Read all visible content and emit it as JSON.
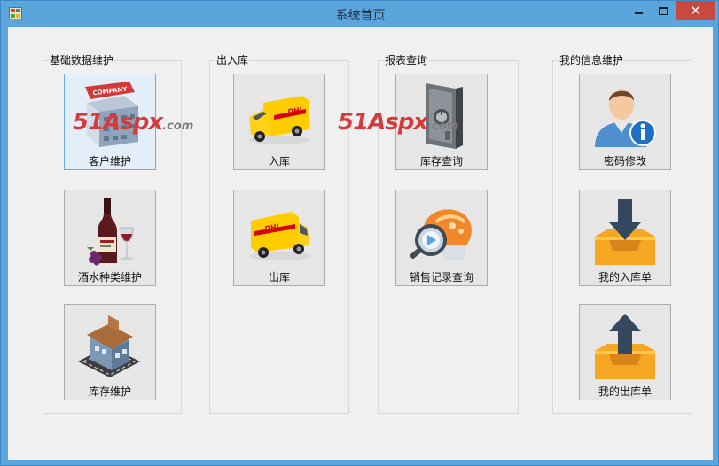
{
  "window": {
    "title": "系统首页",
    "close_glyph": "✕"
  },
  "groups": [
    {
      "caption": "基础数据维护",
      "tiles": [
        {
          "label": "客户维护",
          "icon": "company-building-icon",
          "selected": true
        },
        {
          "label": "酒水种类维护",
          "icon": "wine-bottle-icon",
          "selected": false
        },
        {
          "label": "库存维护",
          "icon": "warehouse-building-icon",
          "selected": false
        }
      ]
    },
    {
      "caption": "出入库",
      "tiles": [
        {
          "label": "入库",
          "icon": "delivery-van-icon",
          "selected": false
        },
        {
          "label": "出库",
          "icon": "delivery-van-icon",
          "selected": false
        }
      ]
    },
    {
      "caption": "报表查询",
      "tiles": [
        {
          "label": "库存查询",
          "icon": "safe-icon",
          "selected": false
        },
        {
          "label": "销售记录查询",
          "icon": "search-report-icon",
          "selected": false
        }
      ]
    },
    {
      "caption": "我的信息维护",
      "tiles": [
        {
          "label": "密码修改",
          "icon": "user-info-icon",
          "selected": false
        },
        {
          "label": "我的入库单",
          "icon": "inbox-download-icon",
          "selected": false
        },
        {
          "label": "我的出库单",
          "icon": "inbox-upload-icon",
          "selected": false
        }
      ]
    }
  ],
  "watermarks": [
    {
      "big": "51Aspx",
      "small": ".com"
    },
    {
      "big": "51Aspx",
      "small": ".com"
    }
  ],
  "colors": {
    "titlebar": "#5ba5dd",
    "close_button": "#c9483f",
    "client": "#f0f0f0",
    "tile_selected": "#e3eef9",
    "van_yellow": "#ffcc00",
    "dhl_red": "#d40511",
    "tray_orange": "#f5a623",
    "arrow_navy": "#34495e"
  }
}
